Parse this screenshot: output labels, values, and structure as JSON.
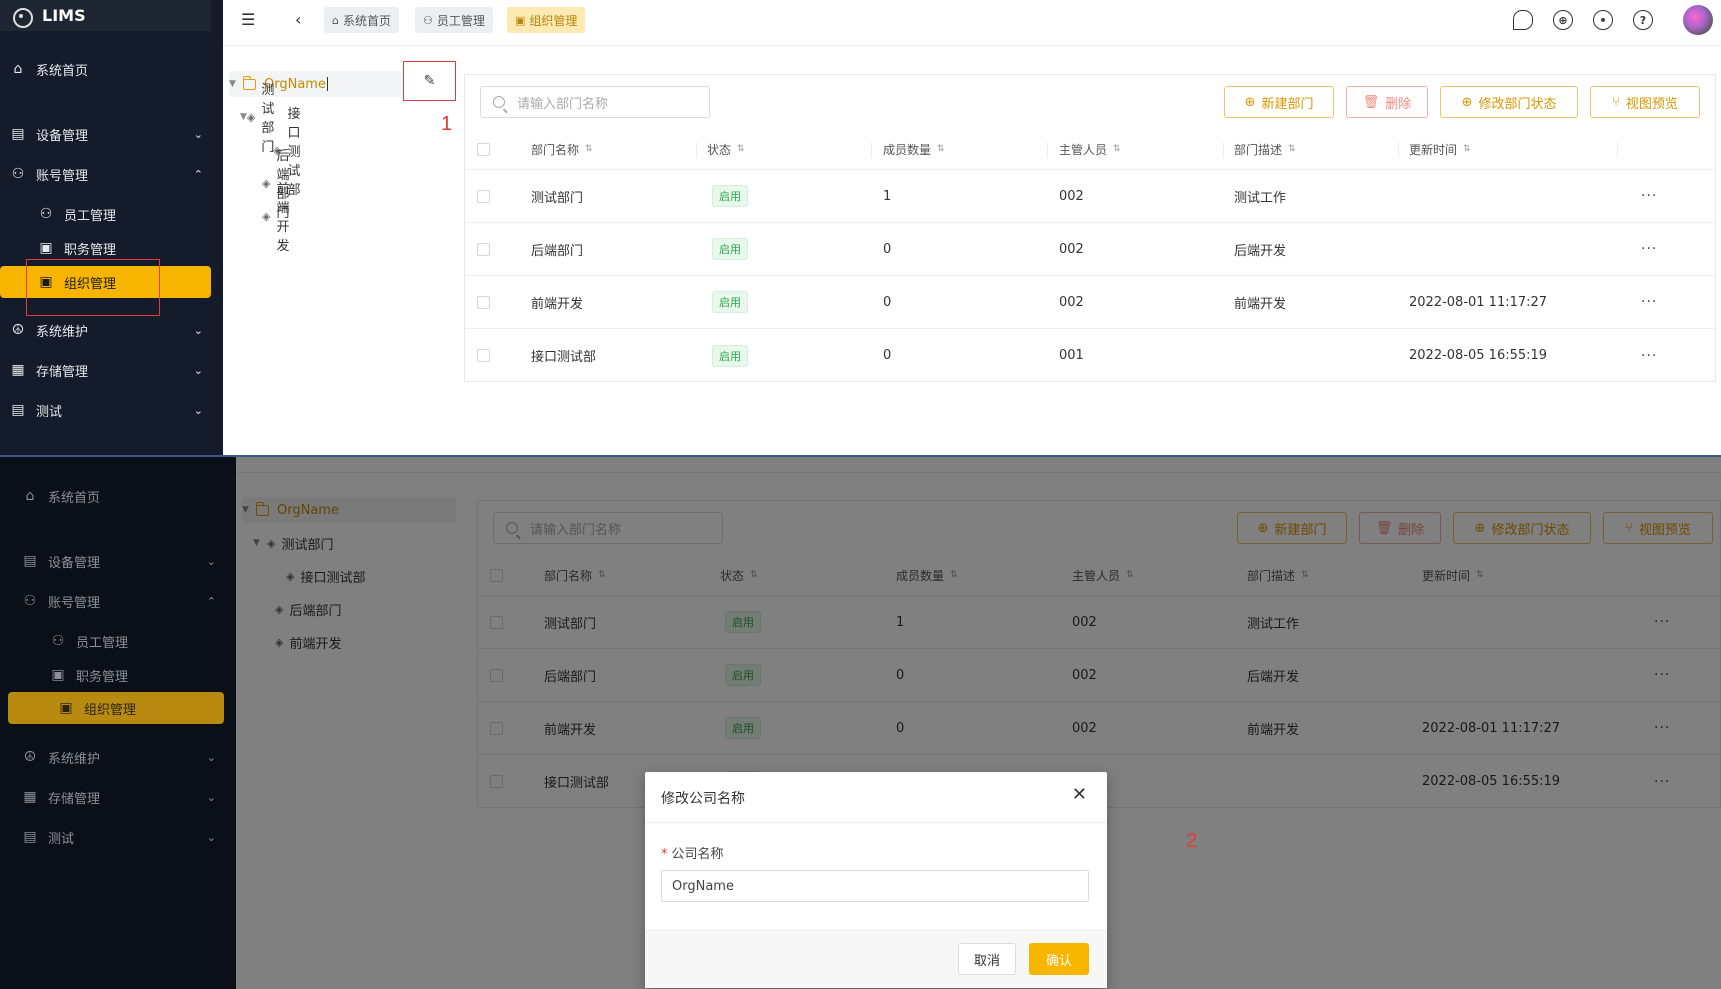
{
  "app": {
    "logo_text": "LIMS"
  },
  "sidebar": {
    "items": [
      {
        "label": "系统首页",
        "icon": "home-icon"
      },
      {
        "label": "设备管理",
        "icon": "grid-icon"
      },
      {
        "label": "账号管理",
        "icon": "users-icon"
      },
      {
        "label": "员工管理",
        "icon": "users-icon"
      },
      {
        "label": "职务管理",
        "icon": "id-card-icon"
      },
      {
        "label": "组织管理",
        "icon": "id-card-icon"
      },
      {
        "label": "系统维护",
        "icon": "peace-icon"
      },
      {
        "label": "存储管理",
        "icon": "storage-icon"
      },
      {
        "label": "测试",
        "icon": "grid-icon"
      }
    ]
  },
  "header": {
    "tabs": [
      {
        "label": "系统首页"
      },
      {
        "label": "员工管理"
      },
      {
        "label": "组织管理"
      }
    ]
  },
  "tree": {
    "root": "OrgName",
    "nodes": [
      "测试部门",
      "接口测试部",
      "后端部门",
      "前端开发"
    ]
  },
  "toolbar": {
    "search_placeholder": "请输入部门名称",
    "new_dept": "新建部门",
    "delete": "删除",
    "modify_status": "修改部门状态",
    "view_preview": "视图预览"
  },
  "table": {
    "columns": [
      "部门名称",
      "状态",
      "成员数量",
      "主管人员",
      "部门描述",
      "更新时间"
    ],
    "rows": [
      {
        "name": "测试部门",
        "status": "启用",
        "count": "1",
        "manager": "002",
        "desc": "测试工作",
        "updated": ""
      },
      {
        "name": "后端部门",
        "status": "启用",
        "count": "0",
        "manager": "002",
        "desc": "后端开发",
        "updated": ""
      },
      {
        "name": "前端开发",
        "status": "启用",
        "count": "0",
        "manager": "002",
        "desc": "前端开发",
        "updated": "2022-08-01 11:17:27"
      },
      {
        "name": "接口测试部",
        "status": "启用",
        "count": "0",
        "manager": "001",
        "desc": "",
        "updated": "2022-08-05 16:55:19"
      }
    ],
    "more": "···"
  },
  "annotations": {
    "step1": "1",
    "step2": "2"
  },
  "modal": {
    "title": "修改公司名称",
    "field_label": "公司名称",
    "required_mark": "*",
    "input_value": "OrgName",
    "cancel": "取消",
    "confirm": "确认",
    "close": "✕"
  }
}
